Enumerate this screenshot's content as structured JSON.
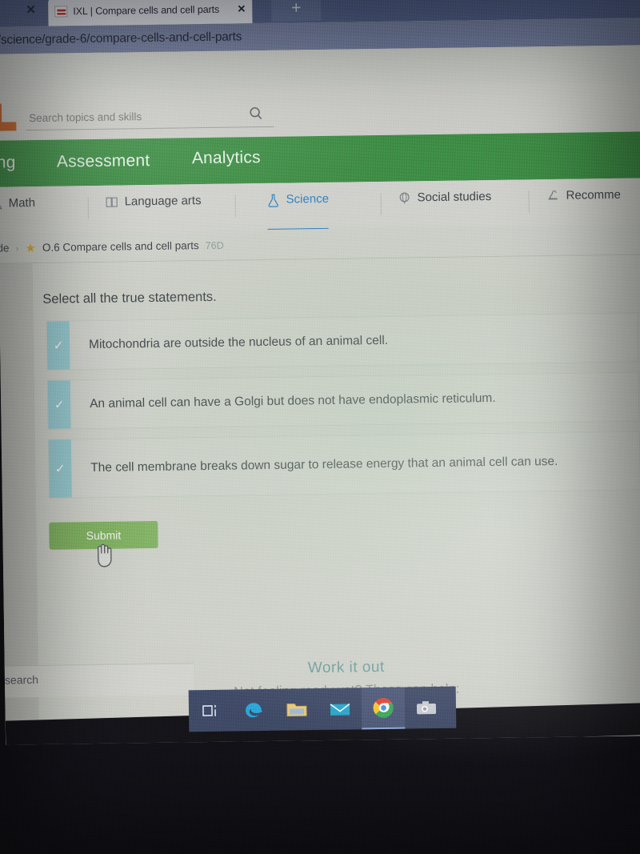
{
  "browser": {
    "tab": {
      "title": "IXL | Compare cells and cell parts",
      "favicon_name": "ixl-favicon",
      "close_label": "✕",
      "left_close_label": "✕"
    },
    "new_tab_label": "+",
    "url": "/science/grade-6/compare-cells-and-cell-parts"
  },
  "site_header": {
    "logo_text": "L",
    "search": {
      "placeholder": "Search topics and skills",
      "value": "",
      "icon_name": "search-icon"
    }
  },
  "green_nav": {
    "items": [
      {
        "label": "ing"
      },
      {
        "label": "Assessment"
      },
      {
        "label": "Analytics"
      }
    ]
  },
  "subject_tabs": {
    "items": [
      {
        "label": "Math",
        "glyph": "△",
        "active": false
      },
      {
        "label": "Language arts",
        "glyph": "Ὅ6",
        "active": false
      },
      {
        "label": "Science",
        "glyph": "⚗",
        "active": true
      },
      {
        "label": "Social studies",
        "glyph": "ἰE",
        "active": false
      },
      {
        "label": "Recomme",
        "glyph": "⚙",
        "active": false
      }
    ]
  },
  "breadcrumb": {
    "grade": "de",
    "chevron": "›",
    "star": "★",
    "skill_title": "O.6 Compare cells and cell parts",
    "skill_code": "76D"
  },
  "main": {
    "question": "Select all the true statements.",
    "answers": [
      {
        "text": "Mitochondria are outside the nucleus of an animal cell.",
        "checked": true,
        "check_glyph": "✓"
      },
      {
        "text": "An animal cell can have a Golgi but does not have endoplasmic reticulum.",
        "checked": true,
        "check_glyph": "✓"
      },
      {
        "text": "The cell membrane breaks down sugar to release energy that an animal cell can use.",
        "checked": true,
        "check_glyph": "✓"
      }
    ],
    "submit_label": "Submit",
    "cursor_name": "hand-pointer-cursor"
  },
  "work_it_out": {
    "title": "Work it out",
    "subtitle": "Not feeling ready yet? These can help:"
  },
  "taskbar": {
    "items": [
      {
        "name": "task-view-icon",
        "label": ""
      },
      {
        "name": "edge-browser-icon",
        "label": ""
      },
      {
        "name": "file-explorer-icon",
        "label": ""
      },
      {
        "name": "mail-icon",
        "label": ""
      },
      {
        "name": "chrome-browser-icon",
        "label": "",
        "active": true
      },
      {
        "name": "camera-icon",
        "label": ""
      }
    ],
    "search_label": "search"
  },
  "colors": {
    "ixl_green": "#3e8b45",
    "submit_green": "#7fb061",
    "science_blue": "#2f7fbf",
    "checkbox_teal": "#8cc5ce",
    "logo_orange": "#c4622a",
    "taskbar_blue": "#3f4a66"
  }
}
